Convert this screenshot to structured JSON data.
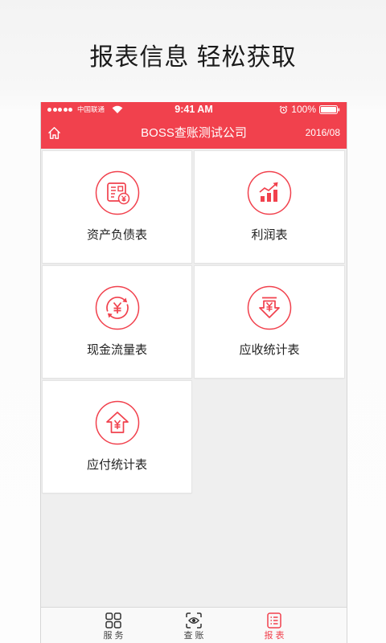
{
  "headline": "报表信息 轻松获取",
  "theme": {
    "accent": "#f1414d",
    "content_background": "#efefef"
  },
  "status_bar": {
    "signal_dots": 5,
    "carrier": "中国联通",
    "wifi_icon": "wifi-icon",
    "time": "9:41 AM",
    "alarm_icon": "alarm-icon",
    "battery_text": "100%",
    "battery_level": 1.0
  },
  "nav": {
    "home_icon": "home-icon",
    "title": "BOSS查账测试公司",
    "date": "2016/08"
  },
  "reports": [
    {
      "label": "资产负债表",
      "icon": "balance-sheet-icon"
    },
    {
      "label": "利润表",
      "icon": "profit-chart-icon"
    },
    {
      "label": "现金流量表",
      "icon": "cash-flow-icon"
    },
    {
      "label": "应收统计表",
      "icon": "receivable-icon"
    },
    {
      "label": "应付统计表",
      "icon": "payable-icon"
    }
  ],
  "tab_bar": {
    "active_index": 2,
    "tabs": [
      {
        "label": "服 务",
        "icon": "grid-icon"
      },
      {
        "label": "查 账",
        "icon": "eye-scan-icon"
      },
      {
        "label": "报 表",
        "icon": "report-list-icon"
      }
    ]
  }
}
